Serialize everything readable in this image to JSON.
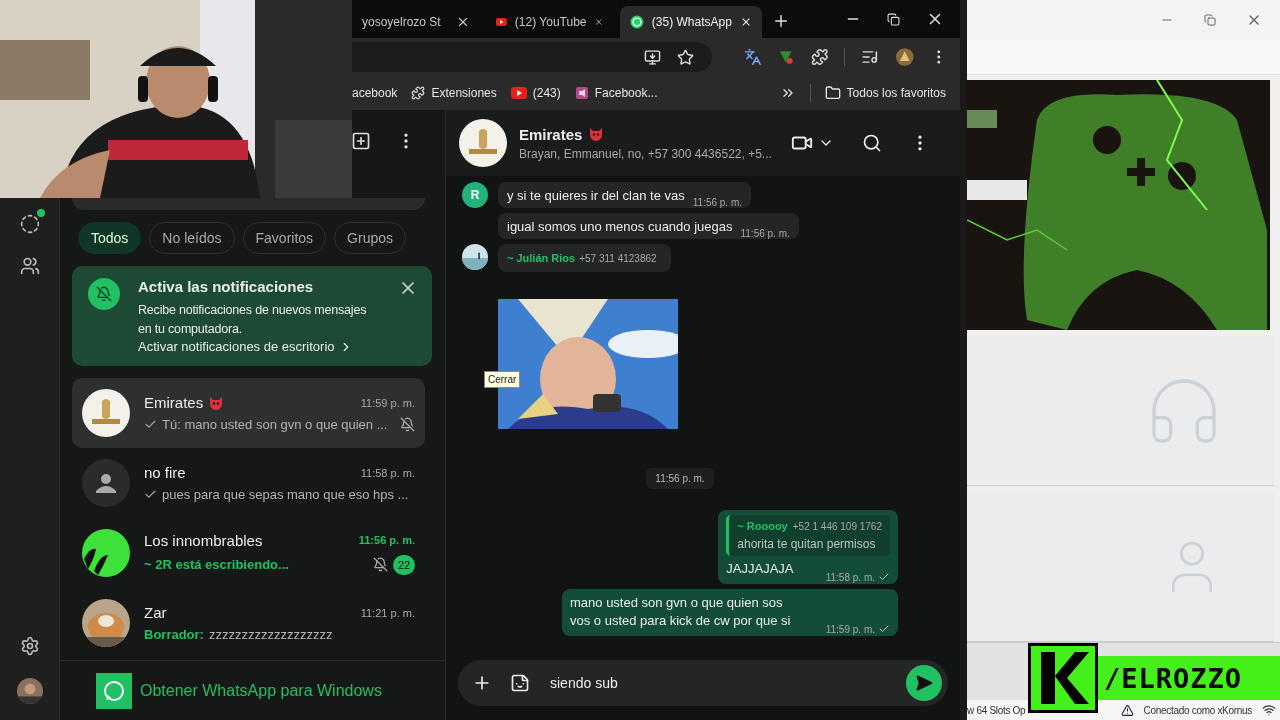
{
  "browser": {
    "tabs": [
      {
        "title": "yosoyelrozo St",
        "kind": "plain",
        "selected": false
      },
      {
        "title": "(12) YouTube",
        "kind": "video",
        "selected": false
      },
      {
        "title": "(35) WhatsApp",
        "kind": "chat",
        "selected": true
      }
    ],
    "bookmarks": [
      {
        "label": "acebook",
        "kind": "plain"
      },
      {
        "label": "Extensiones",
        "kind": "extensions"
      },
      {
        "label": "(243)",
        "kind": "video"
      },
      {
        "label": "Facebook...",
        "kind": "page"
      }
    ],
    "bookmarks_folder": "Todos los favoritos"
  },
  "whatsapp": {
    "filters": [
      {
        "label": "Todos",
        "selected": true
      },
      {
        "label": "No leídos",
        "selected": false
      },
      {
        "label": "Favoritos",
        "selected": false
      },
      {
        "label": "Grupos",
        "selected": false
      }
    ],
    "notice": {
      "title": "Activa las notificaciones",
      "body": "Recibe notificaciones de nuevos mensajes en tu computadora.",
      "link": "Activar notificaciones de escritorio"
    },
    "chats": [
      {
        "kind": "logo",
        "name": "Emirates",
        "emoji": true,
        "time": "11:59 p. m.",
        "tick": true,
        "preview": "Tú: mano usted son gvn o que quien ...",
        "typing": false,
        "muted": true,
        "selected": true
      },
      {
        "kind": "person",
        "name": "no fire",
        "emoji": false,
        "time": "11:58 p. m.",
        "tick": true,
        "preview": "pues para que sepas mano que eso hps ...",
        "typing": false,
        "muted": false,
        "selected": false
      },
      {
        "kind": "group",
        "name": "Los innombrables",
        "emoji": false,
        "time": "11:56 p. m.",
        "tick": false,
        "preview": "~ 2R está escribiendo...",
        "typing": true,
        "muted": true,
        "unread": "22",
        "selected": false
      },
      {
        "name": "Zar",
        "emoji": false,
        "time": "11:21 p. m.",
        "tick": false,
        "draft_label": "Borrador:",
        "preview": "zzzzzzzzzzzzzzzzzzz",
        "typing": false,
        "muted": false,
        "selected": false
      }
    ],
    "get_app": "Obtener WhatsApp para Windows",
    "conversation": {
      "name": "Emirates",
      "emoji": true,
      "members": "Brayan, Emmanuel, no, +57 300 4436522, +5...",
      "messages": [
        {
          "kind": "in",
          "letter": "R",
          "text": "y si te quieres ir del clan te vas",
          "time": "11:56 p. m."
        },
        {
          "kind": "in",
          "text": "igual somos uno menos cuando juegas",
          "time": "11:56 p. m."
        },
        {
          "kind": "sender",
          "sender": "~ Julián Rios",
          "phone": "+57 311 4123862"
        },
        {
          "kind": "sticker",
          "tooltip": "Cerrar"
        },
        {
          "kind": "divider",
          "text": "11:56 p. m."
        },
        {
          "kind": "out",
          "quote": {
            "author": "~ Rooooy",
            "phone": "+52 1 446 109 1762",
            "text": "ahorita te quitan permisos"
          },
          "text": "JAJJAJAJA",
          "time": "11:58 p. m.",
          "tick": true
        },
        {
          "kind": "out",
          "text": "mano usted son gvn o que quien sos vos o usted para kick de cw por que si",
          "time": "11:59 p. m.",
          "tick": true
        }
      ],
      "composer": {
        "value": "siendo sub"
      }
    }
  },
  "side_app": {
    "status_left": "w 64 Slots Op",
    "status_right": "Conectado como xKornus"
  },
  "overlay": {
    "brand": "/ELROZZO"
  }
}
